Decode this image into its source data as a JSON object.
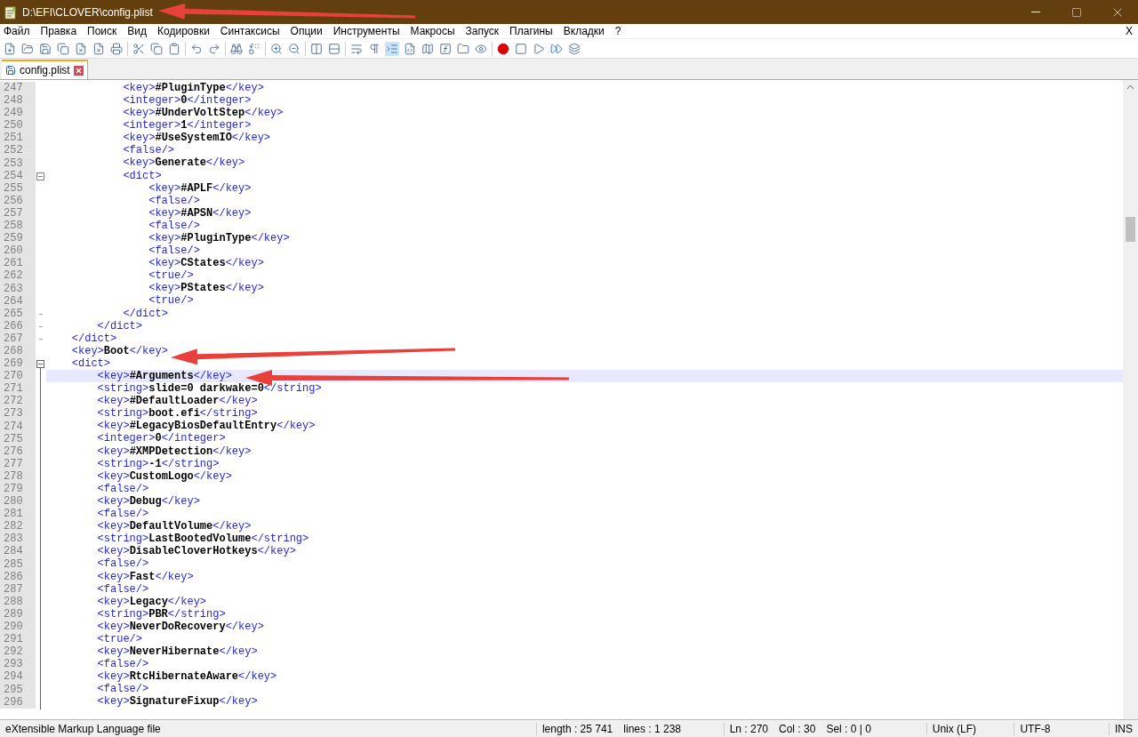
{
  "window": {
    "title": "D:\\EFI\\CLOVER\\config.plist"
  },
  "menu": [
    "Файл",
    "Правка",
    "Поиск",
    "Вид",
    "Кодировки",
    "Синтаксисы",
    "Опции",
    "Инструменты",
    "Макросы",
    "Запуск",
    "Плагины",
    "Вкладки",
    "?"
  ],
  "menu_close": "X",
  "tabs": [
    {
      "label": "config.plist",
      "selected": true
    }
  ],
  "editor": {
    "lines": [
      {
        "number": "247",
        "text": "            <key>#PluginType</key>",
        "selected": false,
        "kind": "plain"
      },
      {
        "number": "248",
        "text": "            <integer>0</integer>",
        "selected": false,
        "kind": "plain"
      },
      {
        "number": "249",
        "text": "            <key>#UnderVoltStep</key>",
        "selected": false,
        "kind": "plain"
      },
      {
        "number": "250",
        "text": "            <integer>1</integer>",
        "selected": false,
        "kind": "plain"
      },
      {
        "number": "251",
        "text": "            <key>#UseSystemIO</key>",
        "selected": false,
        "kind": "plain"
      },
      {
        "number": "252",
        "text": "            <false/>",
        "selected": false,
        "kind": "plain"
      },
      {
        "number": "253",
        "text": "            <key>Generate</key>",
        "selected": false,
        "kind": "plain"
      },
      {
        "number": "254",
        "text": "            <dict>",
        "selected": false,
        "kind": "foldstart"
      },
      {
        "number": "255",
        "text": "                <key>#APLF</key>",
        "selected": false,
        "kind": "plain"
      },
      {
        "number": "256",
        "text": "                <false/>",
        "selected": false,
        "kind": "plain"
      },
      {
        "number": "257",
        "text": "                <key>#APSN</key>",
        "selected": false,
        "kind": "plain"
      },
      {
        "number": "258",
        "text": "                <false/>",
        "selected": false,
        "kind": "plain"
      },
      {
        "number": "259",
        "text": "                <key>#PluginType</key>",
        "selected": false,
        "kind": "plain"
      },
      {
        "number": "260",
        "text": "                <false/>",
        "selected": false,
        "kind": "plain"
      },
      {
        "number": "261",
        "text": "                <key>CStates</key>",
        "selected": false,
        "kind": "plain"
      },
      {
        "number": "262",
        "text": "                <true/>",
        "selected": false,
        "kind": "plain"
      },
      {
        "number": "263",
        "text": "                <key>PStates</key>",
        "selected": false,
        "kind": "plain"
      },
      {
        "number": "264",
        "text": "                <true/>",
        "selected": false,
        "kind": "plain"
      },
      {
        "number": "265",
        "text": "            </dict>",
        "selected": false,
        "kind": "foldend"
      },
      {
        "number": "266",
        "text": "        </dict>",
        "selected": false,
        "kind": "foldend"
      },
      {
        "number": "267",
        "text": "    </dict>",
        "selected": false,
        "kind": "foldend"
      },
      {
        "number": "268",
        "text": "    <key>Boot</key>",
        "selected": false,
        "kind": "plain"
      },
      {
        "number": "269",
        "text": "    <dict>",
        "selected": false,
        "kind": "activestart"
      },
      {
        "number": "270",
        "text": "        <key>#Arguments</key>",
        "selected": true,
        "kind": "activebody"
      },
      {
        "number": "271",
        "text": "        <string>slide=0 darkwake=0</string>",
        "selected": false,
        "kind": "activebody"
      },
      {
        "number": "272",
        "text": "        <key>#DefaultLoader</key>",
        "selected": false,
        "kind": "activebody"
      },
      {
        "number": "273",
        "text": "        <string>boot.efi</string>",
        "selected": false,
        "kind": "activebody"
      },
      {
        "number": "274",
        "text": "        <key>#LegacyBiosDefaultEntry</key>",
        "selected": false,
        "kind": "activebody"
      },
      {
        "number": "275",
        "text": "        <integer>0</integer>",
        "selected": false,
        "kind": "activebody"
      },
      {
        "number": "276",
        "text": "        <key>#XMPDetection</key>",
        "selected": false,
        "kind": "activebody"
      },
      {
        "number": "277",
        "text": "        <string>-1</string>",
        "selected": false,
        "kind": "activebody"
      },
      {
        "number": "278",
        "text": "        <key>CustomLogo</key>",
        "selected": false,
        "kind": "activebody"
      },
      {
        "number": "279",
        "text": "        <false/>",
        "selected": false,
        "kind": "activebody"
      },
      {
        "number": "280",
        "text": "        <key>Debug</key>",
        "selected": false,
        "kind": "activebody"
      },
      {
        "number": "281",
        "text": "        <false/>",
        "selected": false,
        "kind": "activebody"
      },
      {
        "number": "282",
        "text": "        <key>DefaultVolume</key>",
        "selected": false,
        "kind": "activebody"
      },
      {
        "number": "283",
        "text": "        <string>LastBootedVolume</string>",
        "selected": false,
        "kind": "activebody"
      },
      {
        "number": "284",
        "text": "        <key>DisableCloverHotkeys</key>",
        "selected": false,
        "kind": "activebody"
      },
      {
        "number": "285",
        "text": "        <false/>",
        "selected": false,
        "kind": "activebody"
      },
      {
        "number": "286",
        "text": "        <key>Fast</key>",
        "selected": false,
        "kind": "activebody"
      },
      {
        "number": "287",
        "text": "        <false/>",
        "selected": false,
        "kind": "activebody"
      },
      {
        "number": "288",
        "text": "        <key>Legacy</key>",
        "selected": false,
        "kind": "activebody"
      },
      {
        "number": "289",
        "text": "        <string>PBR</string>",
        "selected": false,
        "kind": "activebody"
      },
      {
        "number": "290",
        "text": "        <key>NeverDoRecovery</key>",
        "selected": false,
        "kind": "activebody"
      },
      {
        "number": "291",
        "text": "        <true/>",
        "selected": false,
        "kind": "activebody"
      },
      {
        "number": "292",
        "text": "        <key>NeverHibernate</key>",
        "selected": false,
        "kind": "activebody"
      },
      {
        "number": "293",
        "text": "        <false/>",
        "selected": false,
        "kind": "activebody"
      },
      {
        "number": "294",
        "text": "        <key>RtcHibernateAware</key>",
        "selected": false,
        "kind": "activebody"
      },
      {
        "number": "295",
        "text": "        <false/>",
        "selected": false,
        "kind": "activebody"
      },
      {
        "number": "296",
        "text": "        <key>SignatureFixup</key>",
        "selected": false,
        "kind": "activebody"
      }
    ]
  },
  "status_bar": {
    "file_type": "eXtensible Markup Language file",
    "length": "length : 25 741",
    "lines": "lines : 1 238",
    "ln": "Ln : 270",
    "col": "Col : 30",
    "sel": "Sel : 0 | 0",
    "eol": "Unix (LF)",
    "encoding": "UTF-8",
    "mode": "INS"
  }
}
